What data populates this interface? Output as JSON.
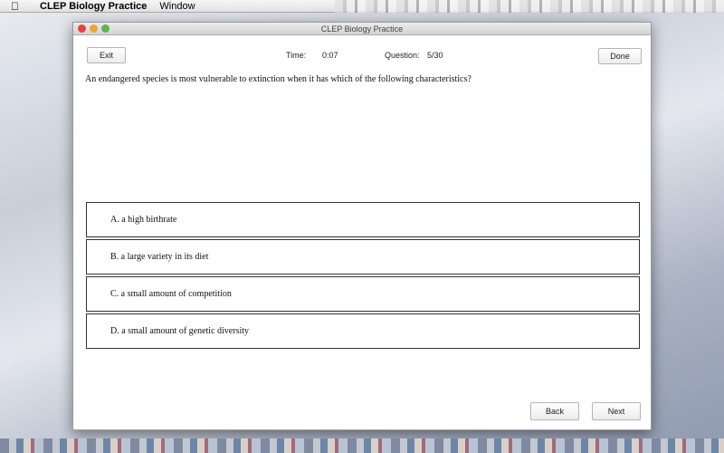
{
  "menubar": {
    "app_name": "CLEP Biology Practice",
    "items": [
      "Window"
    ]
  },
  "window": {
    "title": "CLEP Biology Practice"
  },
  "header": {
    "exit_label": "Exit",
    "time_label": "Time:",
    "time_value": "0:07",
    "question_label": "Question:",
    "question_value": "5/30",
    "done_label": "Done"
  },
  "question": {
    "text": "An endangered species is most vulnerable to extinction when it has which of the following characteristics?"
  },
  "answers": [
    "A. a high birthrate",
    "B. a large variety in its diet",
    "C. a small amount of competition",
    "D. a small amount of genetic diversity"
  ],
  "footer": {
    "back_label": "Back",
    "next_label": "Next"
  }
}
